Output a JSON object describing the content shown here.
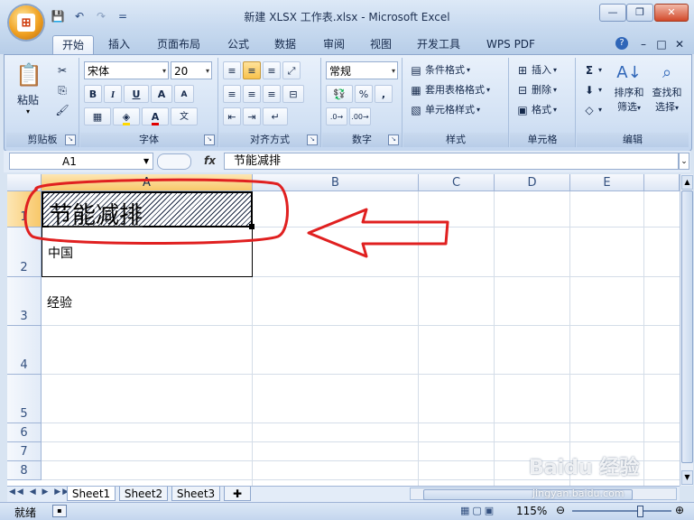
{
  "window": {
    "title": "新建 XLSX 工作表.xlsx - Microsoft Excel",
    "minimize": "—",
    "restore": "❐",
    "close": "✕"
  },
  "qat": {
    "more": "="
  },
  "tabs": [
    "开始",
    "插入",
    "页面布局",
    "公式",
    "数据",
    "审阅",
    "视图",
    "开发工具",
    "WPS PDF"
  ],
  "ribbon_right": {
    "help": "?",
    "min": "–",
    "restore": "□",
    "close": "✕"
  },
  "groups": {
    "clipboard": {
      "label": "剪贴板",
      "paste": "粘贴"
    },
    "font": {
      "label": "字体",
      "font_name": "宋体",
      "font_size": "20",
      "bold": "B",
      "italic": "I",
      "underline": "U",
      "grow": "A",
      "shrink": "A",
      "font_color_letter": "A",
      "phonetic": "文"
    },
    "alignment": {
      "label": "对齐方式"
    },
    "number": {
      "label": "数字",
      "format": "常规",
      "percent": "%",
      "comma": ","
    },
    "styles": {
      "label": "样式",
      "conditional": "条件格式",
      "table": "套用表格格式",
      "cell_styles": "单元格样式"
    },
    "cells": {
      "label": "单元格",
      "insert": "插入",
      "delete": "删除",
      "format": "格式"
    },
    "editing": {
      "label": "编辑",
      "sort": "排序和",
      "sort2": "筛选",
      "find": "查找和",
      "find2": "选择",
      "sum": "Σ"
    }
  },
  "formula_bar": {
    "name_box": "A1",
    "fx": "fx",
    "content": "节能减排"
  },
  "columns": [
    "A",
    "B",
    "C",
    "D",
    "E"
  ],
  "rows": [
    "1",
    "2",
    "3",
    "4",
    "5",
    "6",
    "7",
    "8"
  ],
  "cells": {
    "A1": "节能减排",
    "A2": "中国",
    "A3": "经验"
  },
  "sheets": [
    "Sheet1",
    "Sheet2",
    "Sheet3"
  ],
  "status": {
    "ready": "就绪",
    "zoom": "115%"
  },
  "watermark": {
    "brand": "Baidu 经验",
    "url": "jingyan.baidu.com"
  },
  "colors": {
    "annotation": "#e02020",
    "ribbon": "#d2e1f4",
    "header": "#dde7f5"
  }
}
